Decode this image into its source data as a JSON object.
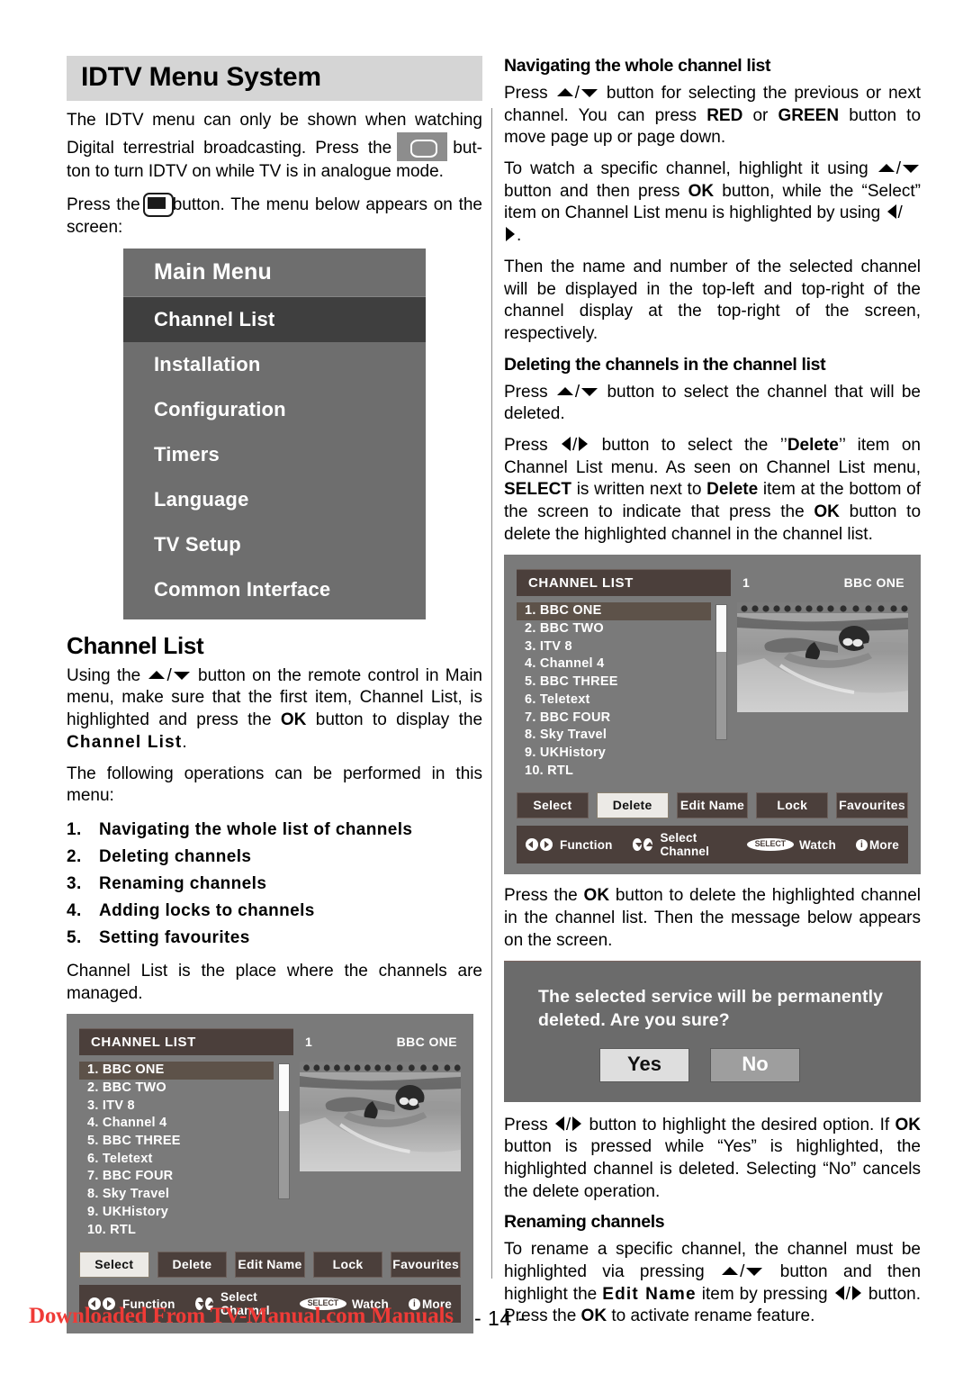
{
  "document": {
    "banner_title": "IDTV Menu System",
    "page_number": "- 14 -",
    "footer_note": "Downloaded From TV-Manual.com Manuals"
  },
  "left_column": {
    "intro": {
      "p1_a": "The IDTV menu can only be shown when watching Digital terrestrial broadcasting. Press the",
      "p1_b": "but-ton to turn IDTV on while TV is in analogue mode.",
      "p2_a": "Press the",
      "p2_b": "button. The menu below appears on the screen:"
    },
    "main_menu": {
      "title": "Main Menu",
      "items": [
        {
          "label": "Channel List",
          "selected": true
        },
        {
          "label": "Installation",
          "selected": false
        },
        {
          "label": "Configuration",
          "selected": false
        },
        {
          "label": "Timers",
          "selected": false
        },
        {
          "label": "Language",
          "selected": false
        },
        {
          "label": "TV Setup",
          "selected": false
        },
        {
          "label": "Common Interface",
          "selected": false
        }
      ]
    },
    "channel_list_section": {
      "heading": "Channel List",
      "p1_a": "Using the",
      "p1_b": "/",
      "p1_c": "button on the remote control in Main menu, make sure that the first item, Channel List, is highlighted and press the",
      "p1_ok": "OK",
      "p1_d": "button to display the",
      "p1_e": "Channel List",
      "p1_f": ".",
      "p2": "The following operations can be performed in this menu:",
      "operations": [
        {
          "num": "1.",
          "label": "Navigating the whole list of channels"
        },
        {
          "num": "2.",
          "label": "Deleting channels"
        },
        {
          "num": "3.",
          "label": "Renaming channels"
        },
        {
          "num": "4.",
          "label": "Adding locks to channels"
        },
        {
          "num": "5.",
          "label": "Setting favourites"
        }
      ],
      "p3": "Channel List is the place where the channels are managed."
    }
  },
  "right_column": {
    "navigating": {
      "heading": "Navigating the whole channel list",
      "p1_a": "Press",
      "p1_b": "/",
      "p1_c": "button for selecting the previous or next channel. You can press",
      "p1_red": "RED",
      "p1_or": "or",
      "p1_green": "GREEN",
      "p1_d": "button to move page up or page down.",
      "p2_a": "To watch a specific channel, highlight it using",
      "p2_b": "/",
      "p2_c": "button and then press",
      "p2_ok": "OK",
      "p2_d": "button, while the “Select” item on Channel List menu is highlighted by using",
      "p2_e": "/",
      "p2_f": ".",
      "p3": "Then the name and number of the selected channel will be displayed in the top-left and top-right of the channel display at the top-right of the screen, respectively."
    },
    "deleting": {
      "heading": "Deleting the channels in the channel list",
      "p1_a": "Press",
      "p1_b": "/",
      "p1_c": "button to select the channel that will be deleted.",
      "p2_a": "Press",
      "p2_b": "/",
      "p2_c": "button to select the ’’",
      "p2_delete": "Delete",
      "p2_d": "’’ item on Channel List menu. As seen on Channel List menu,",
      "p2_select": "SELECT",
      "p2_e": "is written next to",
      "p2_delete2": "Delete",
      "p2_f": "item at the bottom of the screen to indicate that press the",
      "p2_ok": "OK",
      "p2_g": "button to delete the highlighted channel in the channel list.",
      "p3_a": "Press the",
      "p3_ok": "OK",
      "p3_b": "button to delete the highlighted channel in the channel list. Then the message below appears on the screen."
    },
    "confirm_dialog": {
      "message": "The selected service will be permanently deleted. Are you sure?",
      "yes_label": "Yes",
      "no_label": "No"
    },
    "after_dialog": {
      "p1_a": "Press",
      "p1_b": "/",
      "p1_c": "button to highlight the desired option. If",
      "p1_ok": "OK",
      "p1_d": "button is pressed while “Yes” is highlighted, the highlighted channel is deleted. Selecting “No” cancels the delete operation."
    },
    "renaming": {
      "heading": "Renaming channels",
      "p1_a": "To rename a specific channel, the channel must be highlighted via pressing",
      "p1_b": "/",
      "p1_c": "button and then highlight the",
      "p1_edit": "Edit Name",
      "p1_d": "item by pressing",
      "p1_e": "/",
      "p1_f": "button. Press the",
      "p1_ok": "OK",
      "p1_g": "to activate rename feature."
    }
  },
  "osd_screenshot": {
    "title": "CHANNEL LIST",
    "channel_number": "1",
    "channel_name": "BBC ONE",
    "channels": [
      "1. BBC ONE",
      "2. BBC TWO",
      "3. ITV 8",
      "4. Channel 4",
      "5. BBC THREE",
      "6. Teletext",
      "7. BBC FOUR",
      "8. Sky Travel",
      "9. UKHistory",
      "10. RTL"
    ],
    "selected_channel_index": 0,
    "buttons": [
      "Select",
      "Delete",
      "Edit Name",
      "Lock",
      "Favourites"
    ],
    "left_highlighted_button": "Select",
    "right_highlighted_button": "Delete",
    "status_bar": {
      "function_label": "Function",
      "select_channel_label": "Select Channel",
      "select_pill": "SELECT",
      "watch_label": "Watch",
      "more_label": "More"
    }
  },
  "colors": {
    "banner_bg": "#d5d5d5",
    "menu_bg": "#6e6e6e",
    "menu_selected_bg": "#3f3f3f",
    "osd_bg": "#7a7a7a",
    "osd_bar": "#4b3f3b",
    "dialog_bg": "#6b6b6b",
    "footer_red": "#ef3b37"
  }
}
